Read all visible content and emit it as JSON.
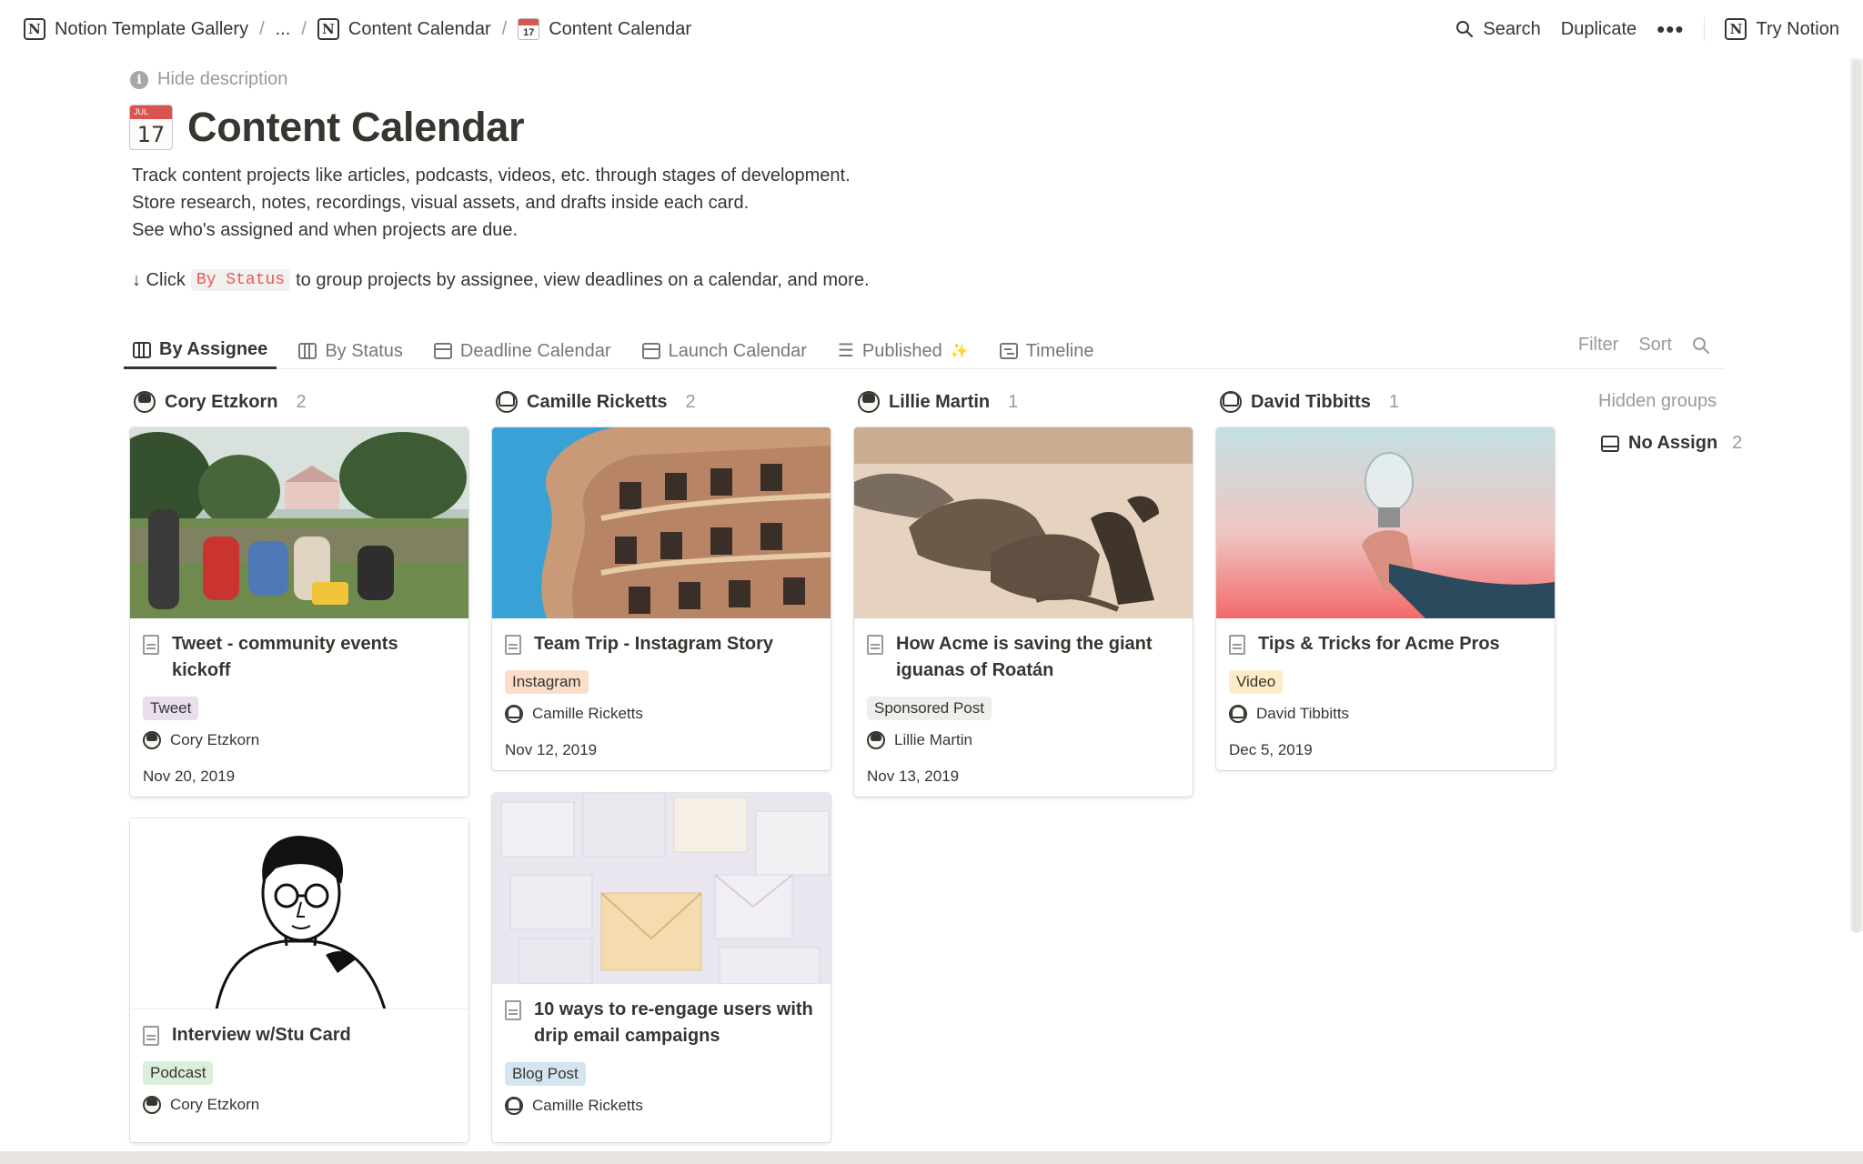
{
  "breadcrumb": {
    "items": [
      "Notion Template Gallery",
      "...",
      "Content Calendar",
      "Content Calendar"
    ],
    "separator": "/",
    "calendar_icon_day": "17"
  },
  "topbar": {
    "search_label": "Search",
    "duplicate_label": "Duplicate",
    "more_label": "•••",
    "try_label": "Try Notion"
  },
  "page": {
    "hide_description": "Hide description",
    "icon_month": "JUL",
    "icon_day": "17",
    "title": "Content Calendar",
    "description": [
      "Track content projects like articles, podcasts, videos, etc. through stages of development.",
      "Store research, notes, recordings, visual assets, and drafts inside each card.",
      "See who's assigned and when projects are due."
    ],
    "hint_prefix": "↓ Click",
    "hint_code": "By Status",
    "hint_suffix": "to group projects by assignee, view deadlines on a calendar, and more."
  },
  "tabs": [
    {
      "label": "By Assignee",
      "icon": "board-icon",
      "active": true
    },
    {
      "label": "By Status",
      "icon": "board-icon",
      "active": false
    },
    {
      "label": "Deadline Calendar",
      "icon": "calendar-icon",
      "active": false
    },
    {
      "label": "Launch Calendar",
      "icon": "calendar-icon",
      "active": false
    },
    {
      "label": "Published",
      "icon": "list-icon",
      "active": false,
      "suffix": "✨"
    },
    {
      "label": "Timeline",
      "icon": "timeline-icon",
      "active": false
    }
  ],
  "tools": {
    "filter": "Filter",
    "sort": "Sort"
  },
  "columns": [
    {
      "name": "Cory Etzkorn",
      "count": "2",
      "cards": [
        {
          "title": [
            "Tweet - community events",
            "kickoff"
          ],
          "tag": "Tweet",
          "tag_color": "#e8deee",
          "person": "Cory Etzkorn",
          "date": "Nov 20, 2019",
          "cover": "festival-crowd"
        },
        {
          "title": [
            "Interview w/Stu Card"
          ],
          "tag": "Podcast",
          "tag_color": "#dbeddb",
          "person": "Cory Etzkorn",
          "date": "",
          "cover": "illustrated-portrait"
        }
      ]
    },
    {
      "name": "Camille Ricketts",
      "count": "2",
      "cards": [
        {
          "title": [
            "Team Trip - Instagram Story"
          ],
          "tag": "Instagram",
          "tag_color": "#fadec9",
          "person": "Camille Ricketts",
          "date": "Nov 12, 2019",
          "cover": "wavy-building"
        },
        {
          "title": [
            "10 ways to re-engage users with",
            "drip email campaigns"
          ],
          "tag": "Blog Post",
          "tag_color": "#d3e5ef",
          "person": "Camille Ricketts",
          "date": "",
          "cover": "envelopes"
        }
      ]
    },
    {
      "name": "Lillie Martin",
      "count": "1",
      "cards": [
        {
          "title": [
            "How Acme is saving the giant",
            "iguanas of Roatán"
          ],
          "tag": "Sponsored Post",
          "tag_color": "#eeeeec",
          "person": "Lillie Martin",
          "date": "Nov 13, 2019",
          "cover": "iguanas"
        }
      ]
    },
    {
      "name": "David Tibbitts",
      "count": "1",
      "cards": [
        {
          "title": [
            "Tips & Tricks for Acme Pros"
          ],
          "tag": "Video",
          "tag_color": "#fdecc8",
          "person": "David Tibbitts",
          "date": "Dec 5, 2019",
          "cover": "lightbulb"
        }
      ]
    }
  ],
  "hidden_groups": {
    "label": "Hidden groups",
    "items": [
      {
        "name": "No Assign",
        "count": "2"
      }
    ]
  }
}
